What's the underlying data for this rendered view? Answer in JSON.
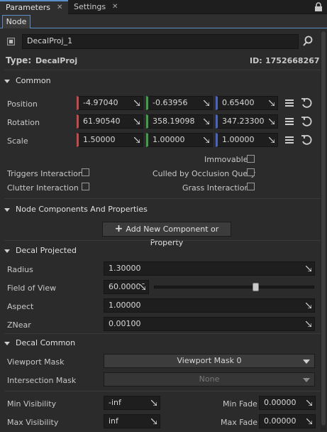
{
  "tabs": [
    {
      "label": "Parameters",
      "active": true
    },
    {
      "label": "Settings",
      "active": false
    }
  ],
  "subtab": "Node",
  "node": {
    "name": "DecalProj_1",
    "type_label": "Type:",
    "type_value": "DecalProj",
    "id_label": "ID:",
    "id_value": "1752668267"
  },
  "common": {
    "title": "Common",
    "rows": [
      {
        "label": "Position",
        "values": [
          "-4.97040",
          "-0.63956",
          "0.65400"
        ]
      },
      {
        "label": "Rotation",
        "values": [
          "61.90540",
          "358.19098",
          "347.23300"
        ]
      },
      {
        "label": "Scale",
        "values": [
          "1.50000",
          "1.00000",
          "1.00000"
        ]
      }
    ],
    "flags": {
      "immovable": "Immovable",
      "triggers": "Triggers Interaction",
      "culled": "Culled by Occlusion Query",
      "clutter": "Clutter Interaction",
      "grass": "Grass Interaction"
    }
  },
  "components": {
    "title": "Node Components And Properties",
    "add_button": "Add New Component or Property"
  },
  "decal_projected": {
    "title": "Decal Projected",
    "radius_label": "Radius",
    "radius": "1.30000",
    "fov_label": "Field of View",
    "fov": "60.00000",
    "fov_slider_fraction": 0.5,
    "aspect_label": "Aspect",
    "aspect": "1.00000",
    "znear_label": "ZNear",
    "znear": "0.00100"
  },
  "decal_common": {
    "title": "Decal Common",
    "viewport_label": "Viewport Mask",
    "viewport_value": "Viewport Mask 0",
    "intersection_label": "Intersection Mask",
    "intersection_value": "None"
  },
  "visibility": {
    "min_vis_label": "Min Visibility",
    "min_vis": "-inf",
    "max_vis_label": "Max Visibility",
    "max_vis": "inf",
    "min_fade_label": "Min Fade",
    "min_fade": "0.00000",
    "max_fade_label": "Max Fade",
    "max_fade": "0.00000"
  },
  "colors": {
    "accent": "#5a8cc6",
    "x_axis": "#c24a4a",
    "y_axis": "#3fa04a",
    "z_axis": "#4a64c2"
  },
  "icons": [
    "close-icon",
    "lock-icon",
    "search-icon",
    "list-menu-icon",
    "reset-icon",
    "expand-arrow-icon",
    "plus-icon",
    "dropdown-arrow-icon"
  ]
}
